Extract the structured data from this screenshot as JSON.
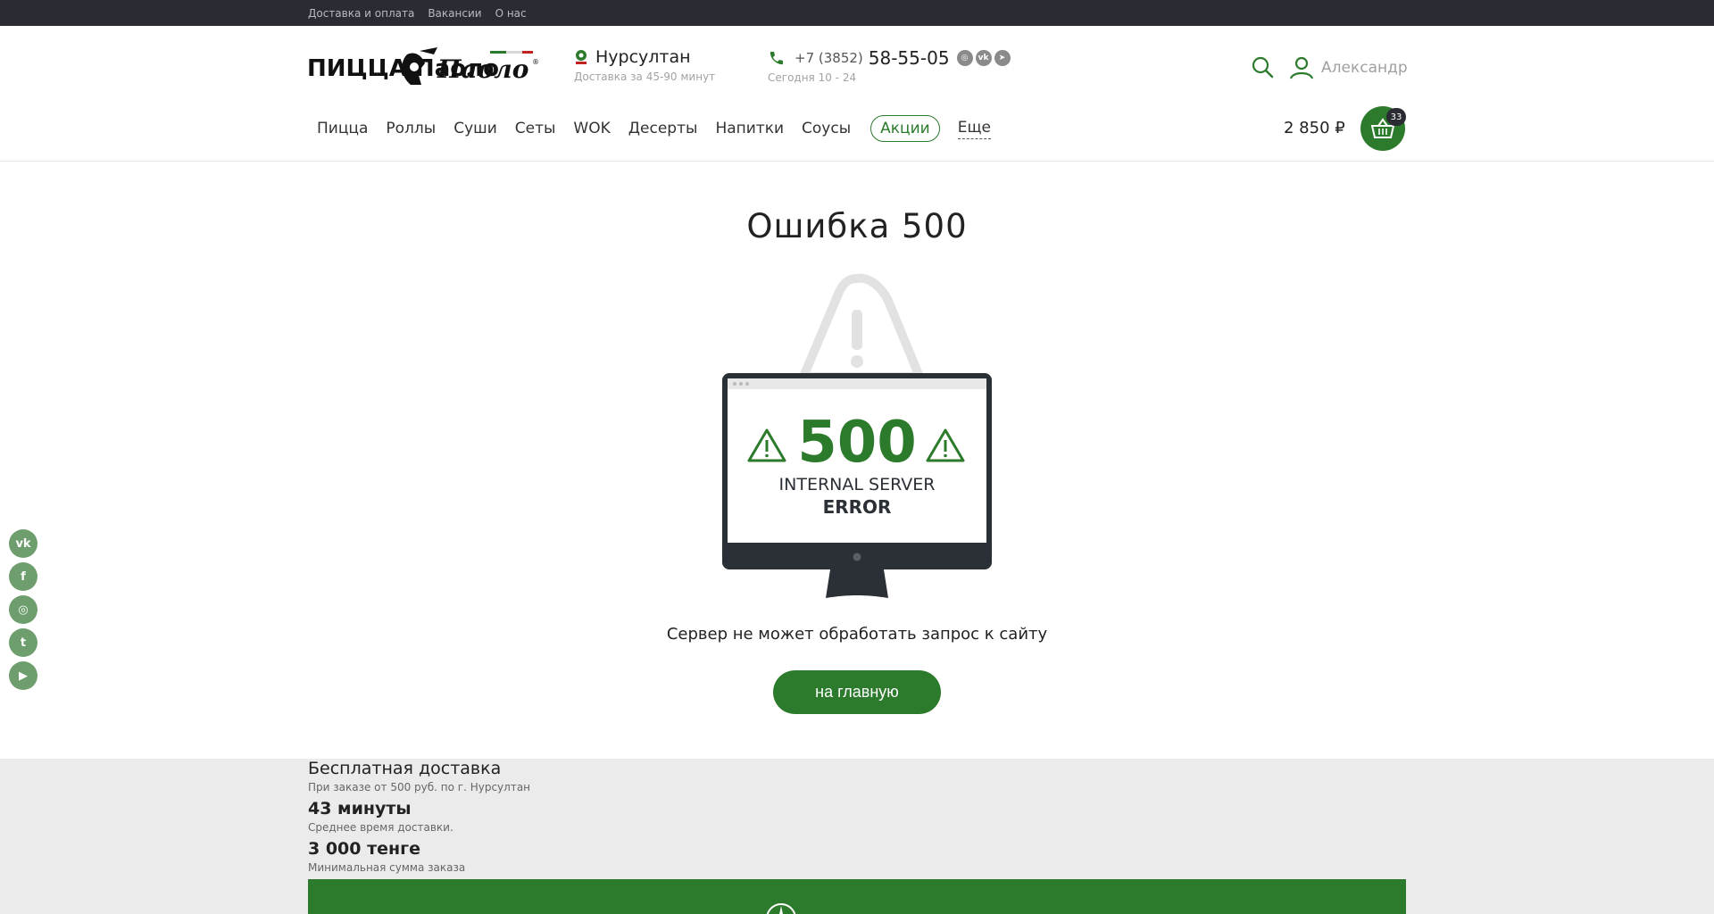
{
  "topbar": {
    "links": [
      "Доставка и оплата",
      "Вакансии",
      "О нас"
    ]
  },
  "header": {
    "logo_text": "ПИЦЦА Паоло",
    "city": "Нурсултан",
    "delivery_note": "Доставка за 45-90 минут",
    "phone_code": "+7 (3852)",
    "phone_main": "58-55-05",
    "phone_hours": "Сегодня 10 - 24",
    "user_name": "Александр"
  },
  "nav": {
    "items": [
      "Пицца",
      "Роллы",
      "Суши",
      "Сеты",
      "WOK",
      "Десерты",
      "Напитки",
      "Соусы"
    ],
    "promo": "Акции",
    "more": "Еще"
  },
  "cart": {
    "total": "2 850 ₽",
    "count": "33"
  },
  "error": {
    "title": "Ошибка 500",
    "code": "500",
    "line1": "INTERNAL SERVER",
    "line2": "ERROR",
    "message": "Сервер не может обработать запрос к сайту",
    "button": "на главную"
  },
  "footer_info": {
    "free_delivery_title": "Бесплатная доставка",
    "free_delivery_note": "При заказе от 500 руб. по г. Нурсултан",
    "avg_time_value": "43 минуты",
    "avg_time_note": "Среднее время доставки.",
    "min_order_value": "3 000 тенге",
    "min_order_note": "Минимальная сумма заказа"
  },
  "side_socials": [
    "vk-icon",
    "facebook-icon",
    "instagram-icon",
    "twitter-icon",
    "youtube-icon"
  ],
  "colors": {
    "brand_green": "#2c7a2c",
    "topbar": "#2b2c33",
    "footer_bg": "#ebebeb"
  }
}
